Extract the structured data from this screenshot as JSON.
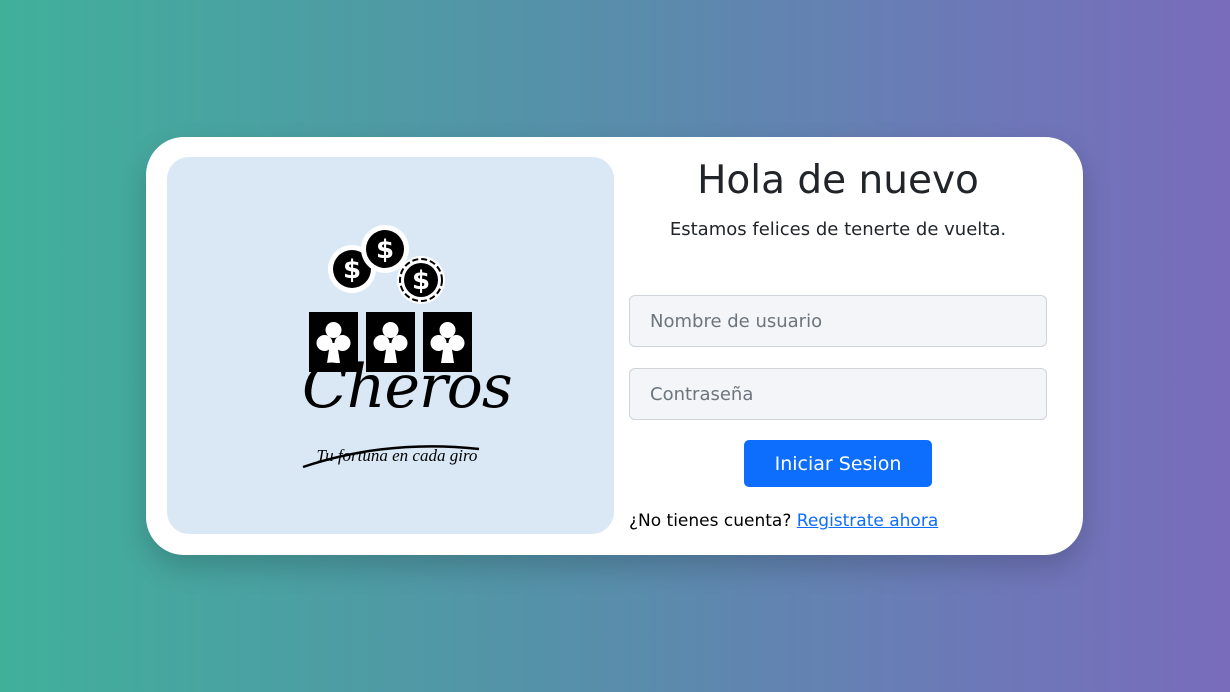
{
  "brand": {
    "name": "Cheros",
    "tagline": "Tu fortuna en cada giro",
    "logo_icons": [
      "dollar-coin-icon",
      "club-card-icon"
    ]
  },
  "login": {
    "title": "Hola de nuevo",
    "subtitle": "Estamos felices de tenerte de vuelta.",
    "username_placeholder": "Nombre de usuario",
    "password_placeholder": "Contraseña",
    "submit_label": "Iniciar Sesion",
    "signup_prompt": "¿No tienes cuenta?",
    "signup_link": "Registrate ahora"
  },
  "colors": {
    "background_start": "#40b09b",
    "background_end": "#786cbb",
    "logo_panel": "#dae8f6",
    "primary": "#0d6efd"
  }
}
